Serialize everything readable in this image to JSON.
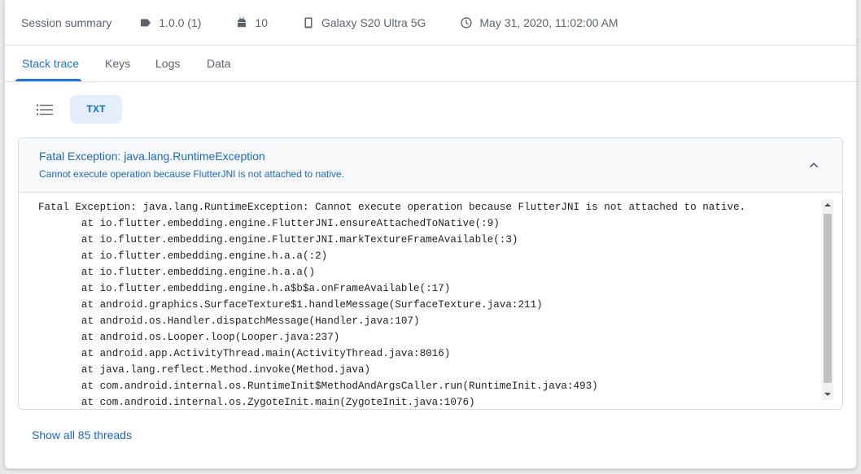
{
  "summary": {
    "title": "Session summary",
    "version": "1.0.0 (1)",
    "android_version": "10",
    "device": "Galaxy S20 Ultra 5G",
    "timestamp": "May 31, 2020, 11:02:00 AM"
  },
  "tabs": [
    {
      "label": "Stack trace",
      "active": true
    },
    {
      "label": "Keys",
      "active": false
    },
    {
      "label": "Logs",
      "active": false
    },
    {
      "label": "Data",
      "active": false
    }
  ],
  "view_toggle": {
    "list_icon": "list-icon",
    "txt_label": "TXT"
  },
  "exception": {
    "title": "Fatal Exception: java.lang.RuntimeException",
    "message": "Cannot execute operation because FlutterJNI is not attached to native.",
    "trace_lines": [
      "Fatal Exception: java.lang.RuntimeException: Cannot execute operation because FlutterJNI is not attached to native.",
      "       at io.flutter.embedding.engine.FlutterJNI.ensureAttachedToNative(:9)",
      "       at io.flutter.embedding.engine.FlutterJNI.markTextureFrameAvailable(:3)",
      "       at io.flutter.embedding.engine.h.a.a(:2)",
      "       at io.flutter.embedding.engine.h.a.a()",
      "       at io.flutter.embedding.engine.h.a$b$a.onFrameAvailable(:17)",
      "       at android.graphics.SurfaceTexture$1.handleMessage(SurfaceTexture.java:211)",
      "       at android.os.Handler.dispatchMessage(Handler.java:107)",
      "       at android.os.Looper.loop(Looper.java:237)",
      "       at android.app.ActivityThread.main(ActivityThread.java:8016)",
      "       at java.lang.reflect.Method.invoke(Method.java)",
      "       at com.android.internal.os.RuntimeInit$MethodAndArgsCaller.run(RuntimeInit.java:493)",
      "       at com.android.internal.os.ZygoteInit.main(ZygoteInit.java:1076)"
    ]
  },
  "footer": {
    "show_all_label": "Show all 85 threads"
  },
  "colors": {
    "accent": "#1a73e8",
    "link": "#1967d2",
    "txt_chip_bg": "#e3edfb"
  }
}
